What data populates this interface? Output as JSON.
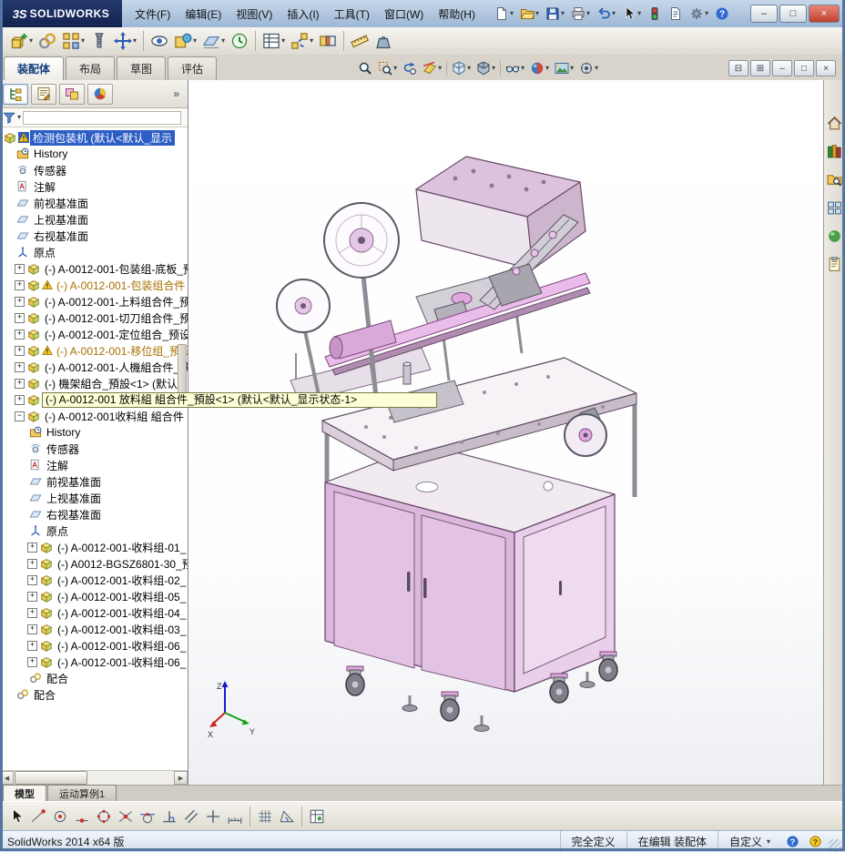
{
  "titlebar": {
    "logo_mark": "3S",
    "logo_text": "SOLIDWORKS",
    "menu": [
      "文件(F)",
      "编辑(E)",
      "视图(V)",
      "插入(I)",
      "工具(T)",
      "窗口(W)",
      "帮助(H)"
    ],
    "quick_tools": [
      {
        "name": "new-document",
        "dropdown": true
      },
      {
        "name": "open-folder",
        "dropdown": true
      },
      {
        "name": "save",
        "dropdown": true
      },
      {
        "name": "print",
        "dropdown": true
      },
      {
        "name": "undo",
        "dropdown": true
      },
      {
        "name": "select-cursor",
        "dropdown": true
      },
      {
        "name": "rebuild"
      },
      {
        "name": "file-properties"
      },
      {
        "name": "options-gear",
        "dropdown": true
      },
      {
        "name": "help"
      }
    ],
    "window_controls": [
      {
        "name": "minimize",
        "glyph": "–"
      },
      {
        "name": "maximize",
        "glyph": "□"
      },
      {
        "name": "close",
        "glyph": "×"
      }
    ]
  },
  "assembly_toolbar": {
    "items": [
      {
        "name": "insert-component",
        "dropdown": true
      },
      {
        "name": "mate"
      },
      {
        "name": "linear-component-pattern",
        "dropdown": true
      },
      {
        "name": "smart-fasteners"
      },
      {
        "name": "move-component",
        "dropdown": true
      },
      {
        "name": "show-hidden-components",
        "sep": true
      },
      {
        "name": "assembly-features",
        "dropdown": true
      },
      {
        "name": "reference-geometry",
        "dropdown": true
      },
      {
        "name": "new-motion-study"
      },
      {
        "name": "bill-of-materials",
        "sep": true,
        "dropdown": true
      },
      {
        "name": "exploded-view",
        "dropdown": true
      },
      {
        "name": "interference-detection"
      },
      {
        "name": "measure",
        "sep": true
      },
      {
        "name": "mass-properties"
      }
    ]
  },
  "command_manager": {
    "tabs": [
      {
        "label": "装配体",
        "active": true
      },
      {
        "label": "布局",
        "active": false
      },
      {
        "label": "草图",
        "active": false
      },
      {
        "label": "评估",
        "active": false
      }
    ]
  },
  "headsup_toolbar": {
    "items": [
      {
        "name": "zoom-fit"
      },
      {
        "name": "zoom-area",
        "dropdown": true
      },
      {
        "name": "previous-view"
      },
      {
        "name": "section-view",
        "dropdown": true
      },
      {
        "name": "view-orientation",
        "dropdown": true,
        "sep": true
      },
      {
        "name": "display-style",
        "dropdown": true
      },
      {
        "name": "hide-show-items",
        "dropdown": true,
        "sep": true
      },
      {
        "name": "edit-appearance",
        "dropdown": true
      },
      {
        "name": "apply-scene",
        "dropdown": true
      },
      {
        "name": "view-settings",
        "dropdown": true
      }
    ]
  },
  "doc_controls": [
    {
      "name": "pane-split-horizontal",
      "glyph": "⊟"
    },
    {
      "name": "pane-split-vertical",
      "glyph": "⊞"
    },
    {
      "name": "doc-minimize",
      "glyph": "–"
    },
    {
      "name": "doc-restore",
      "glyph": "□"
    },
    {
      "name": "doc-close",
      "glyph": "×"
    }
  ],
  "feature_panel": {
    "tabs": [
      "featuremanager",
      "propertymanager",
      "configurationmanager",
      "displaymanager"
    ],
    "chevron": "»",
    "items": [
      {
        "label": "检测包装机 (默认<默认_显示",
        "icon": "assembly",
        "indent": 0,
        "warn": true,
        "selected": true
      },
      {
        "label": "History",
        "icon": "history",
        "indent": 1
      },
      {
        "label": "传感器",
        "icon": "sensor",
        "indent": 1
      },
      {
        "label": "注解",
        "icon": "annotation",
        "indent": 1
      },
      {
        "label": "前视基准面",
        "icon": "plane",
        "indent": 1
      },
      {
        "label": "上视基准面",
        "icon": "plane",
        "indent": 1
      },
      {
        "label": "右视基准面",
        "icon": "plane",
        "indent": 1
      },
      {
        "label": "原点",
        "icon": "origin",
        "indent": 1
      },
      {
        "label": "(-) A-0012-001-包装组-底板_预",
        "icon": "assembly",
        "indent": 1,
        "expand": "+"
      },
      {
        "label": "(-) A-0012-001-包装组合件",
        "icon": "assembly",
        "indent": 1,
        "expand": "+",
        "warn": true,
        "warn_text": true
      },
      {
        "label": "(-) A-0012-001-上料组合件_预",
        "icon": "assembly",
        "indent": 1,
        "expand": "+"
      },
      {
        "label": "(-) A-0012-001-切刀组合件_预",
        "icon": "assembly",
        "indent": 1,
        "expand": "+"
      },
      {
        "label": "(-) A-0012-001-定位组合_预设",
        "icon": "assembly",
        "indent": 1,
        "expand": "+"
      },
      {
        "label": "(-) A-0012-001-移位组_預設",
        "icon": "assembly",
        "indent": 1,
        "expand": "+",
        "warn": true,
        "warn_text": true
      },
      {
        "label": "(-) A-0012-001-人機組合件_预",
        "icon": "assembly",
        "indent": 1,
        "expand": "+"
      },
      {
        "label": "(-) 機架組合_預設<1> (默认",
        "icon": "assembly",
        "indent": 1,
        "expand": "+"
      },
      {
        "label": "(-) A-0012-001 放料組 組合件_預設<1> (默认<默认_显示状态-1>",
        "icon": "assembly",
        "indent": 1,
        "expand": "+",
        "tooltip": true
      },
      {
        "label": "(-) A-0012-001收料組 組合件",
        "icon": "assembly",
        "indent": 1,
        "expand": "-"
      },
      {
        "label": "History",
        "icon": "history",
        "indent": 2
      },
      {
        "label": "传感器",
        "icon": "sensor",
        "indent": 2
      },
      {
        "label": "注解",
        "icon": "annotation",
        "indent": 2
      },
      {
        "label": "前视基准面",
        "icon": "plane",
        "indent": 2
      },
      {
        "label": "上视基准面",
        "icon": "plane",
        "indent": 2
      },
      {
        "label": "右视基准面",
        "icon": "plane",
        "indent": 2
      },
      {
        "label": "原点",
        "icon": "origin",
        "indent": 2
      },
      {
        "label": "(-) A-0012-001-收料组-01_",
        "icon": "assembly",
        "indent": 2,
        "expand": "+"
      },
      {
        "label": "(-) A0012-BGSZ6801-30_预",
        "icon": "assembly",
        "indent": 2,
        "expand": "+"
      },
      {
        "label": "(-) A-0012-001-收料组-02_",
        "icon": "assembly",
        "indent": 2,
        "expand": "+"
      },
      {
        "label": "(-) A-0012-001-收料组-05_",
        "icon": "assembly",
        "indent": 2,
        "expand": "+"
      },
      {
        "label": "(-) A-0012-001-收料组-04_",
        "icon": "assembly",
        "indent": 2,
        "expand": "+"
      },
      {
        "label": "(-) A-0012-001-收料组-03_",
        "icon": "assembly",
        "indent": 2,
        "expand": "+"
      },
      {
        "label": "(-) A-0012-001-收料组-06_",
        "icon": "assembly",
        "indent": 2,
        "expand": "+"
      },
      {
        "label": "(-) A-0012-001-收料组-06_",
        "icon": "assembly",
        "indent": 2,
        "expand": "+"
      },
      {
        "label": "配合",
        "icon": "mates",
        "indent": 2
      },
      {
        "label": "配合",
        "icon": "mates",
        "indent": 1
      }
    ]
  },
  "viewport": {
    "triad": {
      "x": "X",
      "y": "Y",
      "z": "Z"
    }
  },
  "task_pane": {
    "items": [
      "home",
      "design-library",
      "file-explorer",
      "view-palette",
      "appearances-scenes",
      "custom-properties"
    ]
  },
  "doc_tabs": {
    "items": [
      {
        "label": "模型",
        "active": true
      },
      {
        "label": "运动算例1",
        "active": false
      }
    ]
  },
  "snap_bar": {
    "items": [
      {
        "name": "select-tool"
      },
      {
        "name": "point-snap"
      },
      {
        "name": "center-snap"
      },
      {
        "name": "midpoint-snap"
      },
      {
        "name": "quadrant-snap"
      },
      {
        "name": "intersection-snap"
      },
      {
        "name": "tangent-snap"
      },
      {
        "name": "perpendicular-snap"
      },
      {
        "name": "parallel-snap"
      },
      {
        "name": "horizontal-vertical-snap"
      },
      {
        "name": "length-snap"
      },
      {
        "name": "grid-snap",
        "sep": true
      },
      {
        "name": "angle-snap"
      },
      {
        "name": "snap-options",
        "sep": true
      }
    ]
  },
  "status_bar": {
    "left": "SolidWorks 2014 x64 版",
    "defined": "完全定义",
    "editing": "在编辑 装配体",
    "custom": "自定义"
  }
}
